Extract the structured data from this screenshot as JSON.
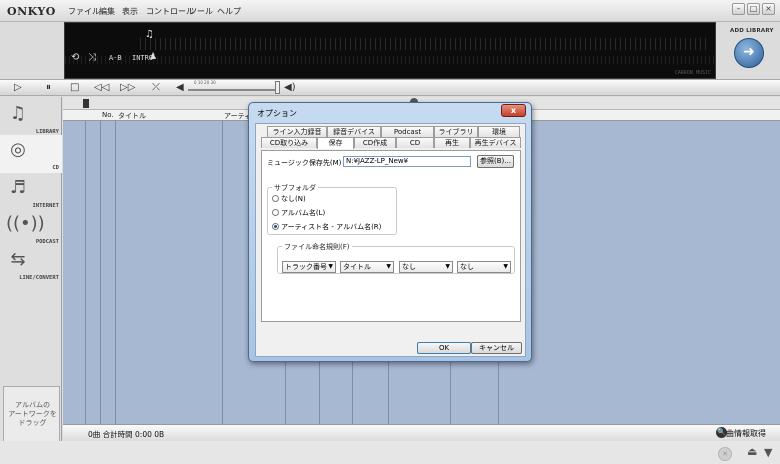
{
  "app": {
    "brand": "ONKYO",
    "menu": [
      "ファイル",
      "編集",
      "表示",
      "コントロール",
      "ツール",
      "ヘルプ"
    ]
  },
  "display": {
    "note": "♫",
    "ab": "A-B",
    "intro": "INTRO",
    "brand_small": "CARRON MUSIC"
  },
  "add_library": {
    "label": "ADD LIBRARY"
  },
  "transport": {
    "volume_scale": "0     10     20     30",
    "volume_level": 1.0
  },
  "sidebar": {
    "items": [
      {
        "label": "LIBRARY",
        "icon": "library-icon"
      },
      {
        "label": "CD",
        "icon": "cd-icon"
      },
      {
        "label": "INTERNET",
        "icon": "internet-icon"
      },
      {
        "label": "PODCAST",
        "icon": "podcast-icon"
      },
      {
        "label": "LINE/CONVERT",
        "icon": "line-convert-icon"
      }
    ],
    "artwork_drop": "アルバムの\nアートワークを\nドラッグ"
  },
  "list": {
    "columns": [
      "No.",
      "タイトル",
      "アーティ"
    ]
  },
  "bottom": {
    "track_count": "0曲  合計時間  0:00  0B",
    "info_fetch": "曲情報取得"
  },
  "dialog": {
    "title": "オプション",
    "close": "x",
    "tabs_row1": [
      "ライン入力録音",
      "録音デバイス",
      "Podcast",
      "ライブラリ",
      "環境"
    ],
    "tabs_row2": [
      "CD取り込み",
      "保存",
      "CD作成",
      "CD",
      "再生",
      "再生デバイス"
    ],
    "active_tab": "保存",
    "save_dest_label": "ミュージック保存先(M)",
    "save_dest_value": "N:¥JAZZ-LP_New¥",
    "browse": "参照(B)...",
    "subfolder_title": "サブフォルダ",
    "subfolder_options": [
      "なし(N)",
      "アルバム名(L)",
      "アーティスト名 - アルバム名(R)"
    ],
    "subfolder_selected": 2,
    "naming_title": "ファイル命名規則(F)",
    "naming_selects": [
      "トラック番号",
      "タイトル",
      "なし",
      "なし"
    ],
    "ok": "OK",
    "cancel": "キャンセル"
  }
}
